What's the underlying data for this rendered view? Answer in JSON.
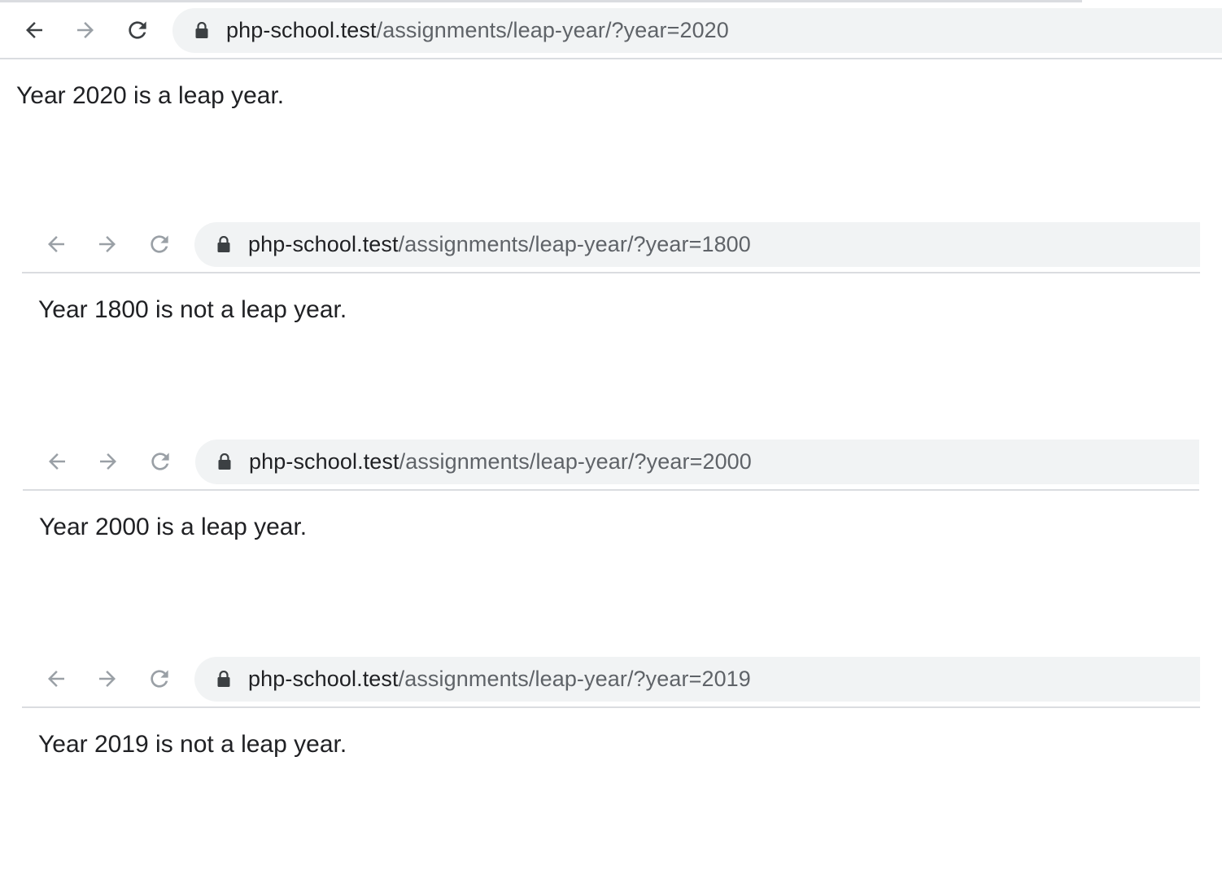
{
  "screenshots": [
    {
      "url_host": "php-school.test",
      "url_path": "/assignments/leap-year/?year=2020",
      "message": "Year 2020 is a leap year."
    },
    {
      "url_host": "php-school.test",
      "url_path": "/assignments/leap-year/?year=1800",
      "message": "Year 1800 is not a leap year."
    },
    {
      "url_host": "php-school.test",
      "url_path": "/assignments/leap-year/?year=2000",
      "message": "Year 2000 is a leap year."
    },
    {
      "url_host": "php-school.test",
      "url_path": "/assignments/leap-year/?year=2019",
      "message": "Year 2019 is not a leap year."
    }
  ],
  "icons": {
    "back": "arrow-left-icon",
    "forward": "arrow-right-icon",
    "reload": "reload-icon",
    "lock": "lock-icon"
  },
  "colors": {
    "active_icon": "#3c4043",
    "disabled_icon": "#9aa0a6",
    "omnibox_bg": "#f1f3f4",
    "url_path": "#5f6368"
  }
}
